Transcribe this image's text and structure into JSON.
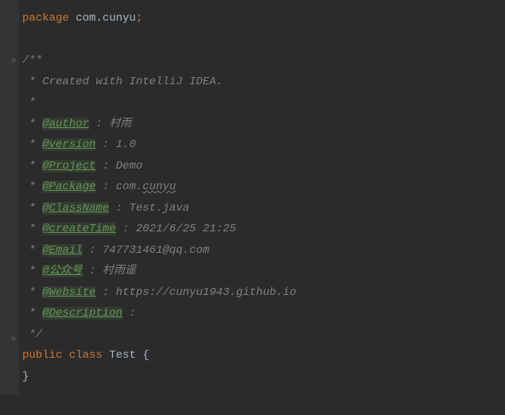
{
  "code": {
    "package_kw": "package",
    "package_name": " com.cunyu",
    "semicolon": ";",
    "doc_open": "/**",
    "star": " *",
    "created_line": " * Created with IntelliJ IDEA.",
    "star_only": " *",
    "prefix": " * ",
    "tags": {
      "author": "@author",
      "author_val": " : 村雨",
      "version": "@version",
      "version_val": " : 1.0",
      "project": "@Project",
      "project_val": " : Demo",
      "package": "@Package",
      "package_val_pre": " : com.",
      "package_val_wavy": "cunyu",
      "classname": "@ClassName",
      "classname_val": " : Test.java",
      "createtime": "@createTime",
      "createtime_val": " : 2021/6/25 21:25",
      "email": "@Email",
      "email_val": " : 747731461@qq.com",
      "wechat": "@公众号",
      "wechat_val": " : 村雨遥",
      "website": "@Website",
      "website_val": " : https://cunyu1943.github.io",
      "description": "@Description",
      "description_val": " :"
    },
    "doc_close": " */",
    "public_kw": "public",
    "class_kw": "class",
    "class_name": "Test",
    "open_brace": " {",
    "close_brace": "}"
  }
}
